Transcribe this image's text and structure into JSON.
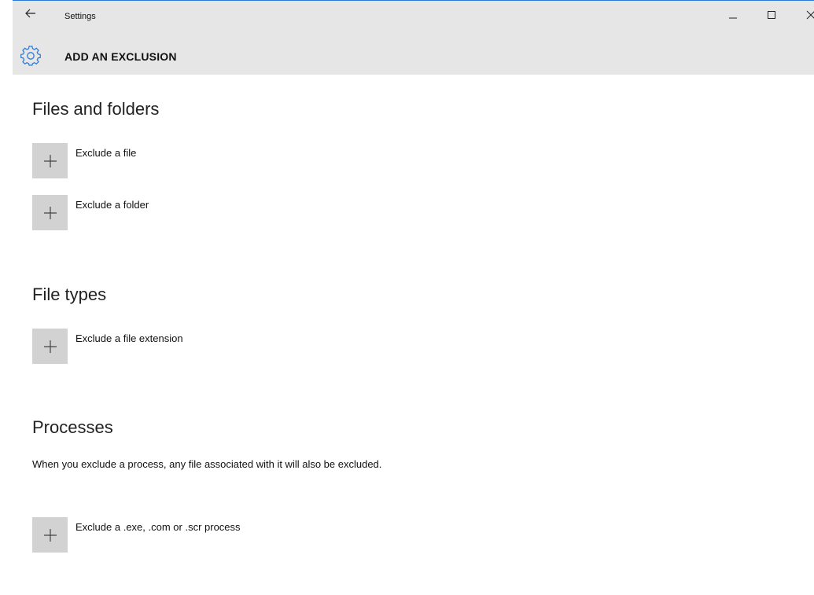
{
  "window": {
    "title": "Settings",
    "minimize_glyph": "–",
    "maximize_glyph": "□",
    "close_glyph": "✕",
    "back_glyph": "←"
  },
  "header": {
    "title": "ADD AN EXCLUSION",
    "icon": "gear-icon",
    "accent": "#2b7bd6"
  },
  "sections": {
    "files_folders": {
      "title": "Files and folders",
      "items": [
        "Exclude a file",
        "Exclude a folder"
      ]
    },
    "file_types": {
      "title": "File types",
      "items": [
        "Exclude a file extension"
      ]
    },
    "processes": {
      "title": "Processes",
      "description": "When you exclude a process, any file associated with it will also be excluded.",
      "items": [
        "Exclude a .exe, .com or .scr process"
      ]
    }
  }
}
